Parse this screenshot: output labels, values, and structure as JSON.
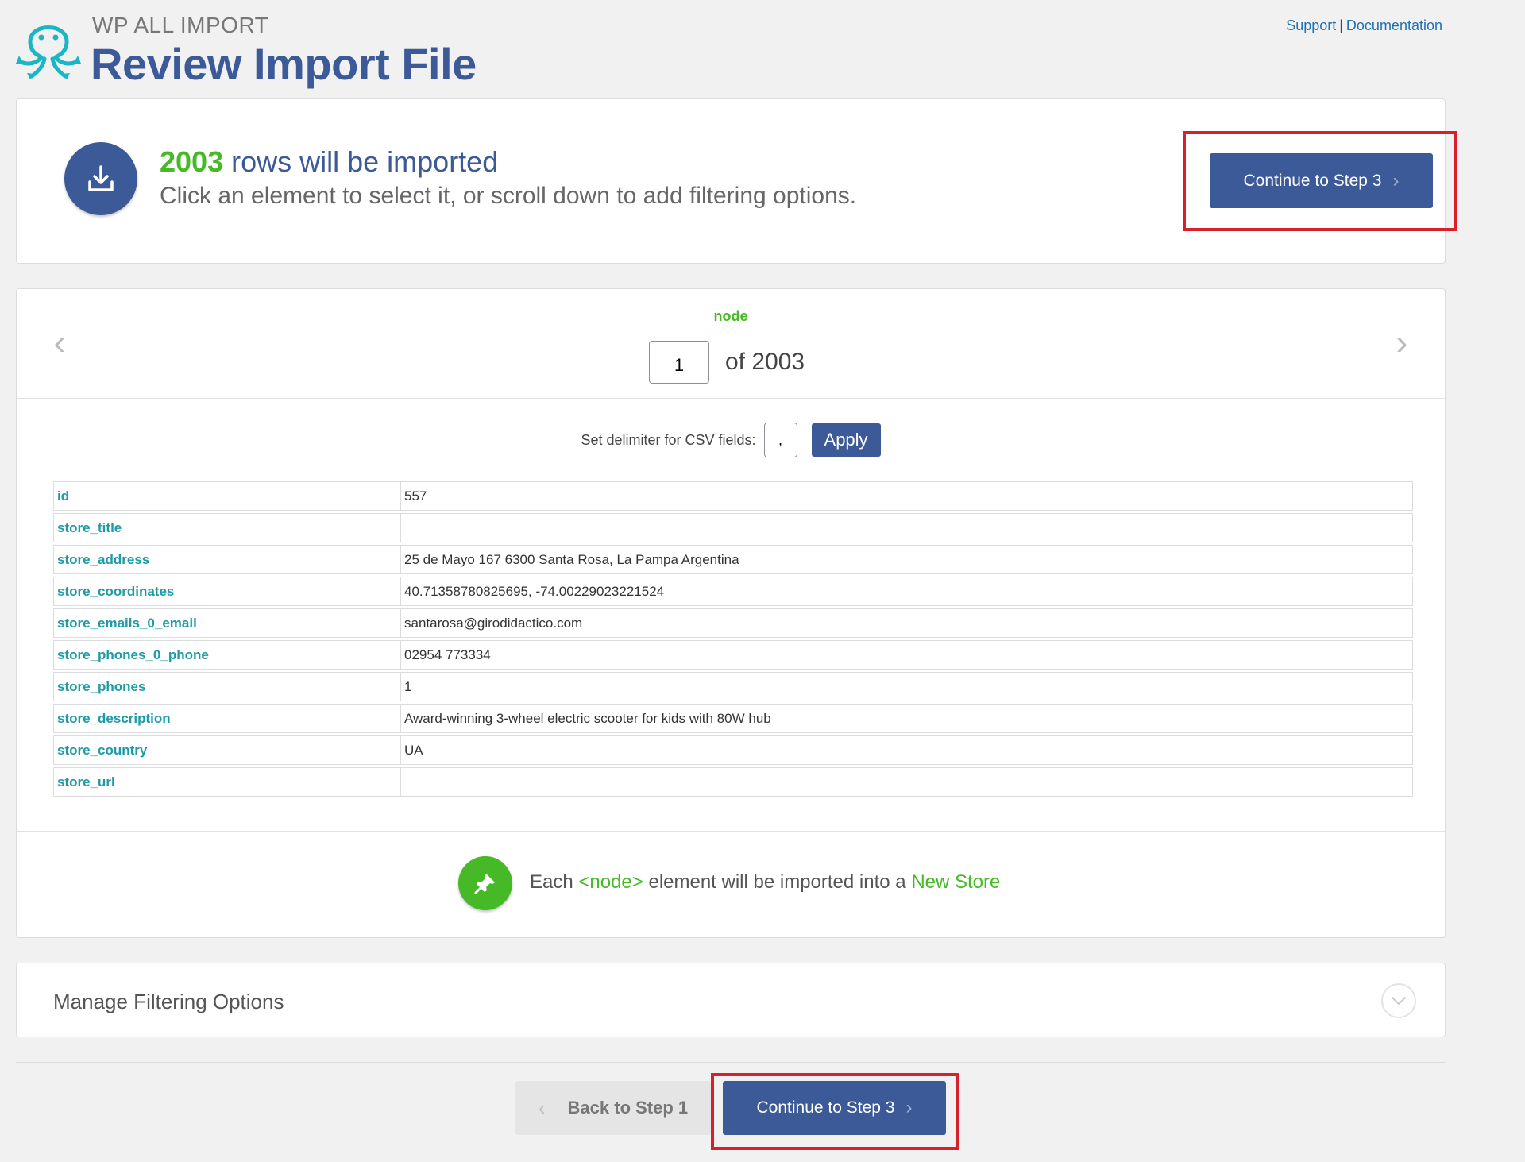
{
  "header": {
    "brand": "WP ALL IMPORT",
    "title": "Review Import File",
    "links": {
      "support": "Support",
      "separator": "|",
      "documentation": "Documentation"
    }
  },
  "summary": {
    "count": "2003",
    "rows_text": "rows will be imported",
    "hint": "Click an element to select it, or scroll down to add filtering options.",
    "continue_label": "Continue to Step 3"
  },
  "preview": {
    "node_label": "node",
    "current": "1",
    "of_label": "of 2003",
    "delimiter_label": "Set delimiter for CSV fields:",
    "delimiter_value": ",",
    "apply_label": "Apply",
    "rows": [
      {
        "key": "id",
        "value": "557"
      },
      {
        "key": "store_title",
        "value": ""
      },
      {
        "key": "store_address",
        "value": "25 de Mayo 167 6300 Santa Rosa, La Pampa Argentina"
      },
      {
        "key": "store_coordinates",
        "value": "40.71358780825695, -74.00229023221524"
      },
      {
        "key": "store_emails_0_email",
        "value": "santarosa@girodidactico.com"
      },
      {
        "key": "store_phones_0_phone",
        "value": "02954 773334"
      },
      {
        "key": "store_phones",
        "value": "1"
      },
      {
        "key": "store_description",
        "value": "Award-winning 3-wheel electric scooter for kids with 80W hub"
      },
      {
        "key": "store_country",
        "value": "UA"
      },
      {
        "key": "store_url",
        "value": ""
      }
    ],
    "import_each": "Each",
    "import_node": "<node>",
    "import_middle": "element will be imported into a",
    "import_target": "New Store"
  },
  "filtering": {
    "title": "Manage Filtering Options"
  },
  "footer": {
    "back_label": "Back to Step 1",
    "continue_label": "Continue to Step 3"
  },
  "colors": {
    "primary": "#3d5a98",
    "green": "#46ba26",
    "teal": "#1e9aa8",
    "highlight": "#d8202a"
  },
  "icons": [
    "octopus-logo-icon",
    "download-icon",
    "chevron-left-icon",
    "chevron-right-icon",
    "pushpin-icon",
    "chevron-down-icon"
  ]
}
